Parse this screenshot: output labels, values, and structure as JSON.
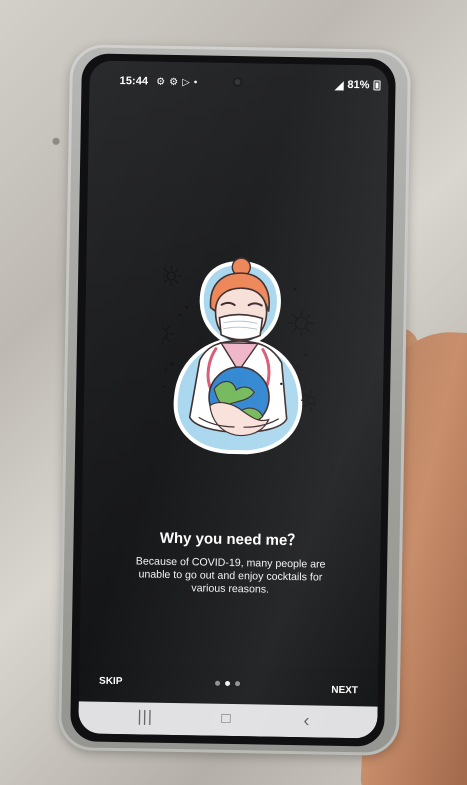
{
  "status_bar": {
    "time": "15:44",
    "icons": [
      "settings-icon",
      "settings-icon",
      "play-store-icon",
      "notification-dot-icon"
    ],
    "battery": "81%"
  },
  "onboarding": {
    "title": "Why you need me？",
    "description": "Because of COVID-19, many people are unable to go out and enjoy cocktails for various reasons.",
    "skip": "SKIP",
    "next": "NEXT",
    "page_indicator": {
      "current": 2,
      "total": 3
    }
  },
  "navigation": {
    "recents": "|||",
    "home": "□",
    "back": "‹"
  },
  "colors": {
    "screen": "#18191b",
    "text": "#ffffff",
    "illustration_bg": "#a9d7ee",
    "face": "#f7dbd4",
    "hair": "#ed8658",
    "globe_blue": "#2f86d1",
    "globe_green": "#73b85a"
  }
}
